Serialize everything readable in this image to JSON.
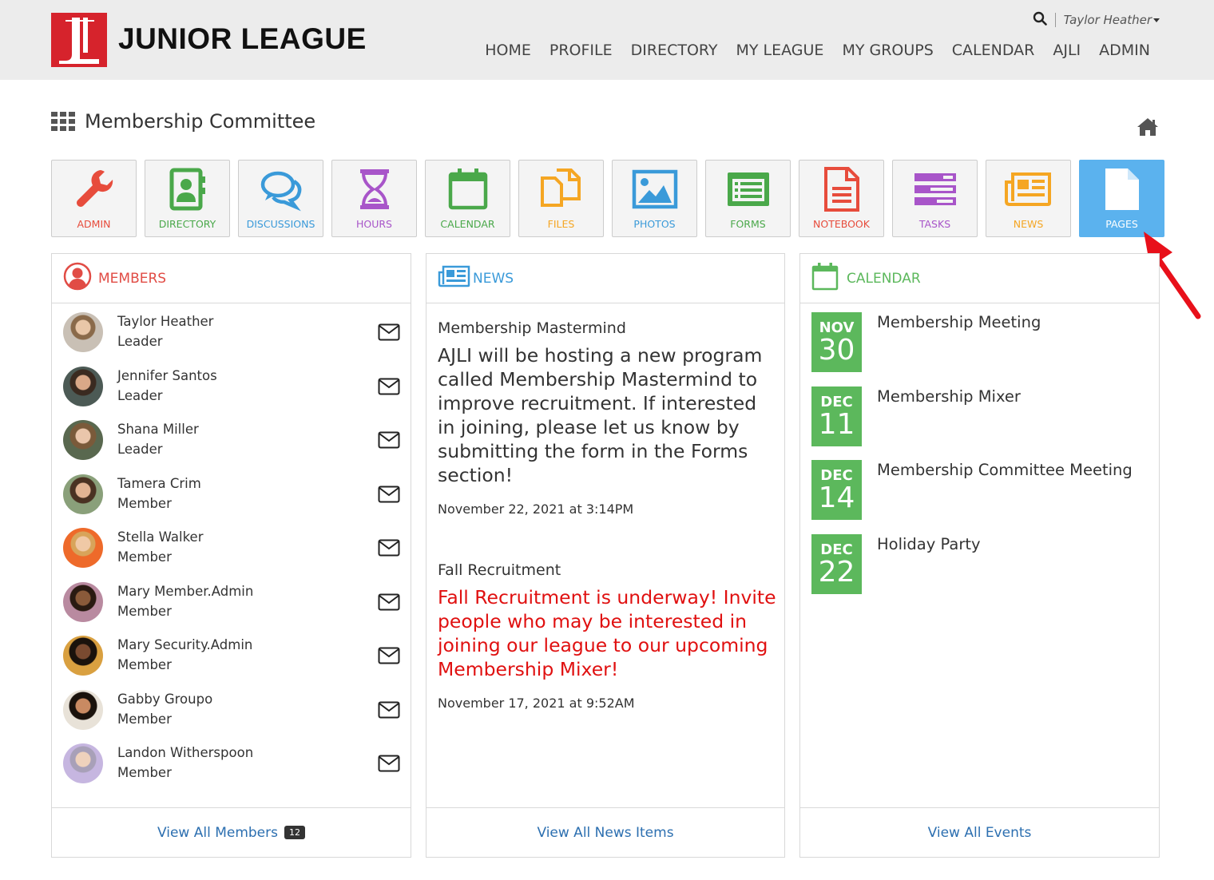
{
  "brand": {
    "logo_letters": "JL",
    "name": "JUNIOR LEAGUE"
  },
  "user_menu": {
    "name": "Taylor Heather"
  },
  "nav": [
    "HOME",
    "PROFILE",
    "DIRECTORY",
    "MY LEAGUE",
    "MY GROUPS",
    "CALENDAR",
    "AJLI",
    "ADMIN"
  ],
  "page": {
    "title": "Membership Committee"
  },
  "tools": [
    {
      "label": "ADMIN",
      "icon": "wrench-icon",
      "color": "#e74c3c"
    },
    {
      "label": "DIRECTORY",
      "icon": "contact-book-icon",
      "color": "#4aa84a"
    },
    {
      "label": "DISCUSSIONS",
      "icon": "chat-bubbles-icon",
      "color": "#3a9ad9"
    },
    {
      "label": "HOURS",
      "icon": "hourglass-icon",
      "color": "#a855c9"
    },
    {
      "label": "CALENDAR",
      "icon": "calendar-icon",
      "color": "#4aa84a"
    },
    {
      "label": "FILES",
      "icon": "files-icon",
      "color": "#f5a623"
    },
    {
      "label": "PHOTOS",
      "icon": "photo-icon",
      "color": "#3a9ad9"
    },
    {
      "label": "FORMS",
      "icon": "form-icon",
      "color": "#4aa84a"
    },
    {
      "label": "NOTEBOOK",
      "icon": "notebook-icon",
      "color": "#e74c3c"
    },
    {
      "label": "TASKS",
      "icon": "tasks-icon",
      "color": "#a855c9"
    },
    {
      "label": "NEWS",
      "icon": "newspaper-icon",
      "color": "#f5a623"
    },
    {
      "label": "PAGES",
      "icon": "page-icon",
      "color": "#ffffff"
    }
  ],
  "members_panel": {
    "title": "MEMBERS",
    "members": [
      {
        "name": "Taylor Heather",
        "role": "Leader"
      },
      {
        "name": "Jennifer Santos",
        "role": "Leader"
      },
      {
        "name": "Shana Miller",
        "role": "Leader"
      },
      {
        "name": "Tamera Crim",
        "role": "Member"
      },
      {
        "name": "Stella Walker",
        "role": "Member"
      },
      {
        "name": "Mary Member.Admin",
        "role": "Member"
      },
      {
        "name": "Mary Security.Admin",
        "role": "Member"
      },
      {
        "name": "Gabby Groupo",
        "role": "Member"
      },
      {
        "name": "Landon Witherspoon",
        "role": "Member"
      }
    ],
    "footer_link": "View All Members",
    "count": "12"
  },
  "news_panel": {
    "title": "NEWS",
    "items": [
      {
        "title": "Membership Mastermind",
        "body": "AJLI will be hosting a new program called Membership Mastermind to improve recruitment. If interested in joining, please let us know by submitting the form in the Forms section!",
        "date": "November 22, 2021 at 3:14PM"
      },
      {
        "title": "Fall Recruitment",
        "body": "Fall Recruitment is underway! Invite people who may be interested in joining our league to our upcoming Membership Mixer!",
        "date": "November 17, 2021 at 9:52AM"
      }
    ],
    "footer_link": "View All News Items"
  },
  "calendar_panel": {
    "title": "CALENDAR",
    "events": [
      {
        "month": "NOV",
        "day": "30",
        "name": "Membership Meeting"
      },
      {
        "month": "DEC",
        "day": "11",
        "name": "Membership Mixer"
      },
      {
        "month": "DEC",
        "day": "14",
        "name": "Membership Committee Meeting"
      },
      {
        "month": "DEC",
        "day": "22",
        "name": "Holiday Party"
      }
    ],
    "footer_link": "View All Events"
  },
  "colors": {
    "members_accent": "#e14c45",
    "news_accent": "#3a9ad9",
    "calendar_accent": "#5cb85c",
    "link": "#2c6fb0",
    "active_tool": "#5bb2ee",
    "arrow": "#e8101a"
  }
}
